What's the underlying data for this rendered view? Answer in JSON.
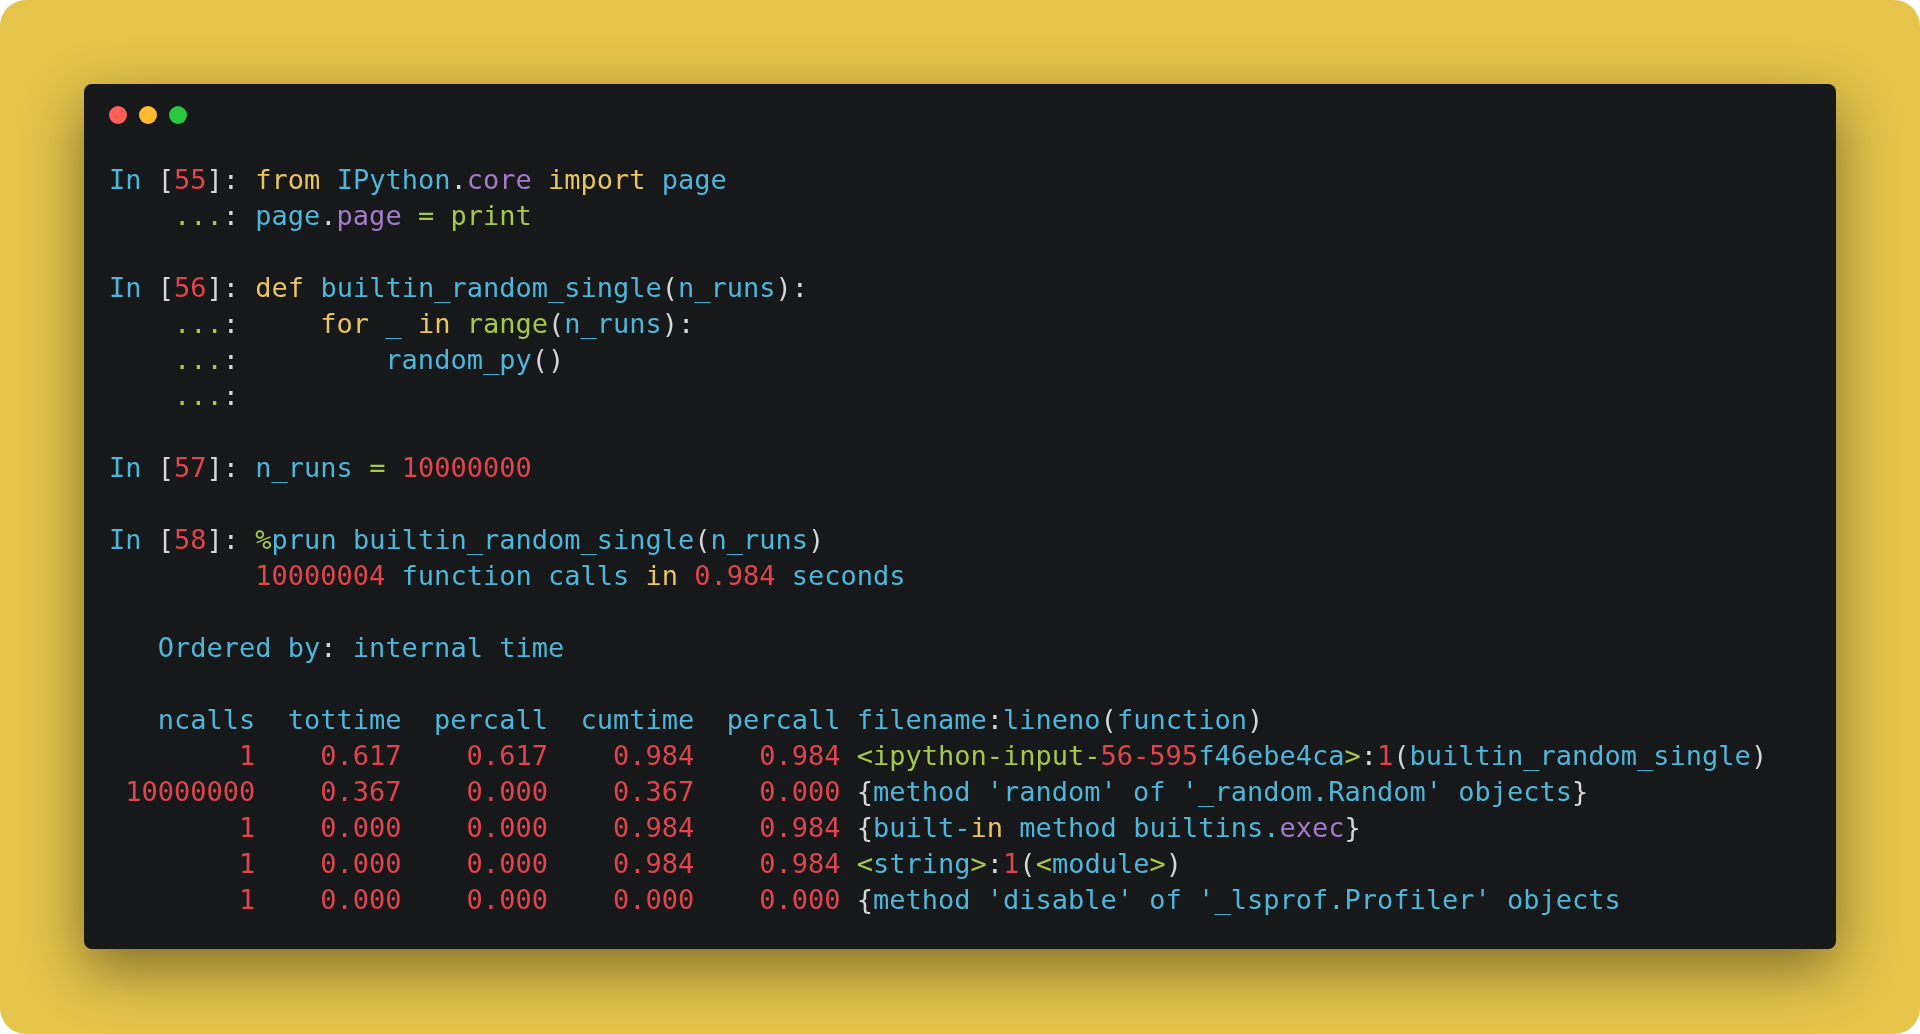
{
  "blocks": [
    {
      "lines": [
        {
          "tokens": [
            {
              "kind": "b",
              "text": "In "
            },
            {
              "kind": "p",
              "text": "["
            },
            {
              "kind": "r",
              "text": "55"
            },
            {
              "kind": "p",
              "text": "]: "
            },
            {
              "kind": "y",
              "text": "from "
            },
            {
              "kind": "b",
              "text": "IPython"
            },
            {
              "kind": "p",
              "text": "."
            },
            {
              "kind": "m",
              "text": "core "
            },
            {
              "kind": "y",
              "text": "import "
            },
            {
              "kind": "b",
              "text": "page"
            }
          ]
        },
        {
          "tokens": [
            {
              "kind": "g",
              "text": "    ..."
            },
            {
              "kind": "p",
              "text": ": "
            },
            {
              "kind": "b",
              "text": "page"
            },
            {
              "kind": "p",
              "text": "."
            },
            {
              "kind": "m",
              "text": "page "
            },
            {
              "kind": "g",
              "text": "= print"
            }
          ]
        }
      ]
    },
    {
      "lines": [
        {
          "tokens": [
            {
              "kind": "b",
              "text": "In "
            },
            {
              "kind": "p",
              "text": "["
            },
            {
              "kind": "r",
              "text": "56"
            },
            {
              "kind": "p",
              "text": "]: "
            },
            {
              "kind": "y",
              "text": "def "
            },
            {
              "kind": "b",
              "text": "builtin_random_single"
            },
            {
              "kind": "p",
              "text": "("
            },
            {
              "kind": "b",
              "text": "n_runs"
            },
            {
              "kind": "p",
              "text": "):"
            }
          ]
        },
        {
          "tokens": [
            {
              "kind": "g",
              "text": "    ..."
            },
            {
              "kind": "p",
              "text": ":     "
            },
            {
              "kind": "y",
              "text": "for "
            },
            {
              "kind": "b",
              "text": "_ "
            },
            {
              "kind": "y",
              "text": "in "
            },
            {
              "kind": "g",
              "text": "range"
            },
            {
              "kind": "p",
              "text": "("
            },
            {
              "kind": "b",
              "text": "n_runs"
            },
            {
              "kind": "p",
              "text": "):"
            }
          ]
        },
        {
          "tokens": [
            {
              "kind": "g",
              "text": "    ..."
            },
            {
              "kind": "p",
              "text": ":         "
            },
            {
              "kind": "b",
              "text": "random_py"
            },
            {
              "kind": "p",
              "text": "()"
            }
          ]
        },
        {
          "tokens": [
            {
              "kind": "g",
              "text": "    ..."
            },
            {
              "kind": "p",
              "text": ":"
            }
          ]
        }
      ]
    },
    {
      "lines": [
        {
          "tokens": [
            {
              "kind": "b",
              "text": "In "
            },
            {
              "kind": "p",
              "text": "["
            },
            {
              "kind": "r",
              "text": "57"
            },
            {
              "kind": "p",
              "text": "]: "
            },
            {
              "kind": "b",
              "text": "n_runs "
            },
            {
              "kind": "g",
              "text": "= "
            },
            {
              "kind": "r",
              "text": "10000000"
            }
          ]
        }
      ]
    },
    {
      "lines": [
        {
          "tokens": [
            {
              "kind": "b",
              "text": "In "
            },
            {
              "kind": "p",
              "text": "["
            },
            {
              "kind": "r",
              "text": "58"
            },
            {
              "kind": "p",
              "text": "]: "
            },
            {
              "kind": "g",
              "text": "%"
            },
            {
              "kind": "b",
              "text": "prun builtin_random_single"
            },
            {
              "kind": "p",
              "text": "("
            },
            {
              "kind": "b",
              "text": "n_runs"
            },
            {
              "kind": "p",
              "text": ")"
            }
          ]
        },
        {
          "tokens": [
            {
              "kind": "r",
              "text": "         10000004 "
            },
            {
              "kind": "b",
              "text": "function calls "
            },
            {
              "kind": "y",
              "text": "in "
            },
            {
              "kind": "r",
              "text": "0.984 "
            },
            {
              "kind": "b",
              "text": "seconds"
            }
          ]
        }
      ]
    },
    {
      "lines": [
        {
          "tokens": [
            {
              "kind": "b",
              "text": "   Ordered by"
            },
            {
              "kind": "p",
              "text": ": "
            },
            {
              "kind": "b",
              "text": "internal time"
            }
          ]
        }
      ]
    },
    {
      "lines": [
        {
          "tokens": [
            {
              "kind": "b",
              "text": "   ncalls  tottime  percall  cumtime  percall filename"
            },
            {
              "kind": "p",
              "text": ":"
            },
            {
              "kind": "b",
              "text": "lineno"
            },
            {
              "kind": "p",
              "text": "("
            },
            {
              "kind": "b",
              "text": "function"
            },
            {
              "kind": "p",
              "text": ")"
            }
          ]
        },
        {
          "tokens": [
            {
              "kind": "r",
              "text": "        1    0.617    0.617    0.984    0.984 "
            },
            {
              "kind": "g",
              "text": "<ipython-input-"
            },
            {
              "kind": "r",
              "text": "56-595"
            },
            {
              "kind": "b",
              "text": "f46ebe4ca"
            },
            {
              "kind": "g",
              "text": ">"
            },
            {
              "kind": "p",
              "text": ":"
            },
            {
              "kind": "r",
              "text": "1"
            },
            {
              "kind": "p",
              "text": "("
            },
            {
              "kind": "b",
              "text": "builtin_random_single"
            },
            {
              "kind": "p",
              "text": ")"
            }
          ]
        },
        {
          "tokens": [
            {
              "kind": "r",
              "text": " 10000000    0.367    0.000    0.367    0.000 "
            },
            {
              "kind": "p",
              "text": "{"
            },
            {
              "kind": "b",
              "text": "method 'random' of '_random.Random' objects"
            },
            {
              "kind": "p",
              "text": "}"
            }
          ]
        },
        {
          "tokens": [
            {
              "kind": "r",
              "text": "        1    0.000    0.000    0.984    0.984 "
            },
            {
              "kind": "p",
              "text": "{"
            },
            {
              "kind": "b",
              "text": "built-"
            },
            {
              "kind": "y",
              "text": "in "
            },
            {
              "kind": "b",
              "text": "method builtins."
            },
            {
              "kind": "m",
              "text": "exec"
            },
            {
              "kind": "p",
              "text": "}"
            }
          ]
        },
        {
          "tokens": [
            {
              "kind": "r",
              "text": "        1    0.000    0.000    0.984    0.984 "
            },
            {
              "kind": "g",
              "text": "<"
            },
            {
              "kind": "b",
              "text": "string"
            },
            {
              "kind": "g",
              "text": ">"
            },
            {
              "kind": "p",
              "text": ":"
            },
            {
              "kind": "r",
              "text": "1"
            },
            {
              "kind": "p",
              "text": "("
            },
            {
              "kind": "g",
              "text": "<"
            },
            {
              "kind": "b",
              "text": "module"
            },
            {
              "kind": "g",
              "text": ">"
            },
            {
              "kind": "p",
              "text": ")"
            }
          ]
        },
        {
          "tokens": [
            {
              "kind": "r",
              "text": "        1    0.000    0.000    0.000    0.000 "
            },
            {
              "kind": "p",
              "text": "{"
            },
            {
              "kind": "b",
              "text": "method 'disable' of '_lsprof.Profiler' objects"
            }
          ]
        }
      ]
    }
  ]
}
